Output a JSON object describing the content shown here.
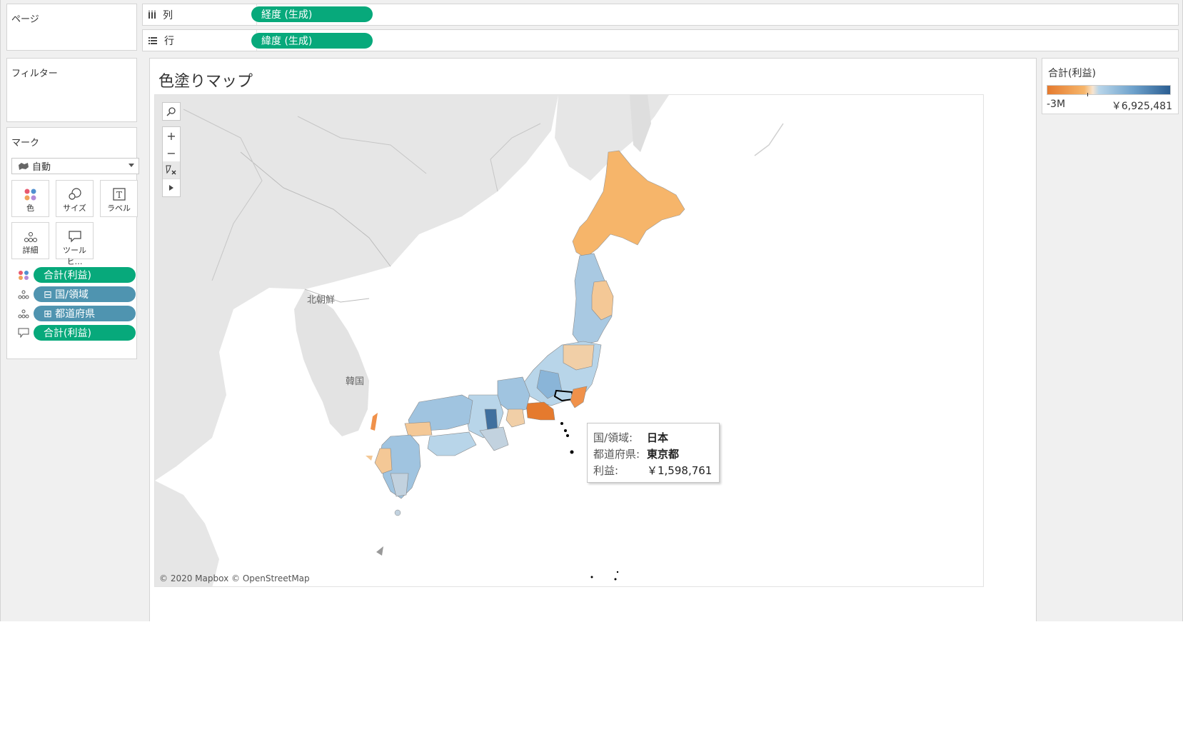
{
  "panels": {
    "pages_title": "ページ",
    "filters_title": "フィルター",
    "marks_title": "マーク"
  },
  "shelves": {
    "columns": {
      "label": "列",
      "pill": "経度 (生成)"
    },
    "rows": {
      "label": "行",
      "pill": "緯度 (生成)"
    }
  },
  "marks": {
    "type_value": "自動",
    "buttons": {
      "color": "色",
      "size": "サイズ",
      "label": "ラベル",
      "detail": "詳細",
      "tooltip": "ツールヒ…"
    },
    "fields": [
      {
        "encoding": "color",
        "label": "合計(利益)"
      },
      {
        "encoding": "detail",
        "label": "⊟ 国/領域"
      },
      {
        "encoding": "detail",
        "label": "⊞ 都道府県"
      },
      {
        "encoding": "tooltip",
        "label": "合計(利益)"
      }
    ]
  },
  "viz": {
    "title": "色塗りマップ",
    "attribution": "© 2020 Mapbox © OpenStreetMap",
    "map_labels": {
      "north_korea": "北朝鮮",
      "south_korea": "韓国"
    },
    "tooltip": {
      "country_key": "国/領域:",
      "country_value": "日本",
      "prefecture_key": "都道府県:",
      "prefecture_value": "東京都",
      "profit_key": "利益:",
      "profit_value": "￥1,598,761"
    }
  },
  "legend": {
    "title": "合計(利益)",
    "min": "-3M",
    "max": "￥6,925,481",
    "colors": {
      "negative": "#e57a2e",
      "neutral": "#f0ede8",
      "positive": "#2b5e92"
    }
  }
}
